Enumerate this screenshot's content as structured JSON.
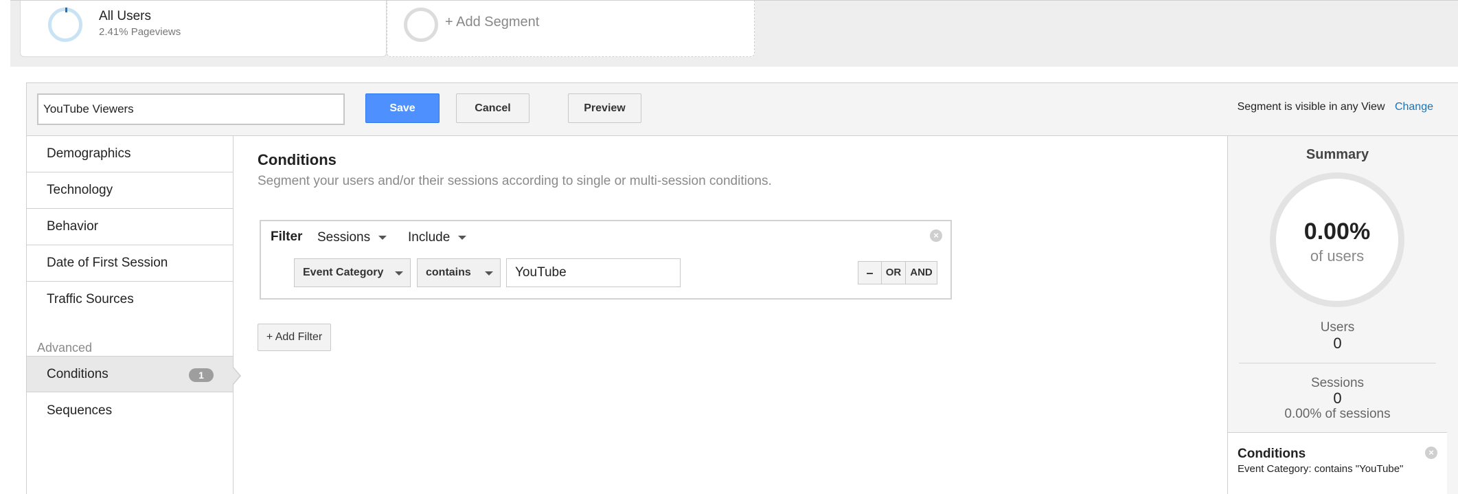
{
  "segments": {
    "all_users": {
      "title": "All Users",
      "subtitle": "2.41% Pageviews"
    },
    "add_segment_label": "+ Add Segment"
  },
  "editor": {
    "segment_name_value": "YouTube Viewers",
    "save_label": "Save",
    "cancel_label": "Cancel",
    "preview_label": "Preview",
    "visibility_text": "Segment is visible in any View",
    "change_label": "Change"
  },
  "nav": {
    "items": [
      {
        "label": "Demographics"
      },
      {
        "label": "Technology"
      },
      {
        "label": "Behavior"
      },
      {
        "label": "Date of First Session"
      },
      {
        "label": "Traffic Sources"
      }
    ],
    "advanced_heading": "Advanced",
    "advanced_items": [
      {
        "label": "Conditions",
        "badge": "1",
        "active": true
      },
      {
        "label": "Sequences"
      }
    ]
  },
  "conditions": {
    "title": "Conditions",
    "subtitle": "Segment your users and/or their sessions according to single or multi-session conditions.",
    "filter": {
      "label": "Filter",
      "scope": "Sessions",
      "mode": "Include",
      "dimension": "Event Category",
      "operator": "contains",
      "value": "YouTube",
      "remove_label": "–",
      "or_label": "OR",
      "and_label": "AND"
    },
    "add_filter_label": "+ Add Filter"
  },
  "summary": {
    "title": "Summary",
    "percent": "0.00%",
    "of_label": "of users",
    "users_label": "Users",
    "users_value": "0",
    "sessions_label": "Sessions",
    "sessions_value": "0",
    "sessions_pct": "0.00% of sessions",
    "conditions_title": "Conditions",
    "conditions_text": "Event Category: contains \"YouTube\""
  },
  "colors": {
    "primary_button": "#4d90fe",
    "link": "#1a73b8",
    "segment_ring": "#c9e3f4"
  }
}
